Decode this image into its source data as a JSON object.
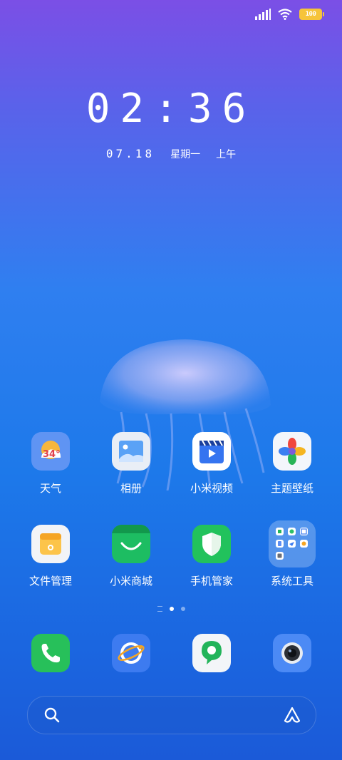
{
  "status": {
    "battery": "100",
    "icons": [
      "signal-icon",
      "wifi-icon",
      "battery-icon"
    ]
  },
  "clock": {
    "time": "02:36",
    "date": "07.18",
    "weekday": "星期一",
    "period": "上午"
  },
  "apps_row1": [
    {
      "label": "天气",
      "badge": "34°",
      "icon": "weather-icon"
    },
    {
      "label": "相册",
      "icon": "gallery-icon"
    },
    {
      "label": "小米视频",
      "icon": "video-icon"
    },
    {
      "label": "主题壁纸",
      "icon": "themes-icon"
    }
  ],
  "apps_row2": [
    {
      "label": "文件管理",
      "icon": "file-manager-icon"
    },
    {
      "label": "小米商城",
      "icon": "mi-store-icon"
    },
    {
      "label": "手机管家",
      "icon": "security-icon"
    },
    {
      "label": "系统工具",
      "icon": "tools-folder-icon"
    }
  ],
  "dock": [
    "phone-icon",
    "browser-icon",
    "messages-icon",
    "camera-icon"
  ],
  "colors": {
    "phone": "#27c05a",
    "browser": "#3d7bf0",
    "store": "#1dbd62",
    "security": "#22c25c",
    "gallery": "#e9eef6"
  }
}
